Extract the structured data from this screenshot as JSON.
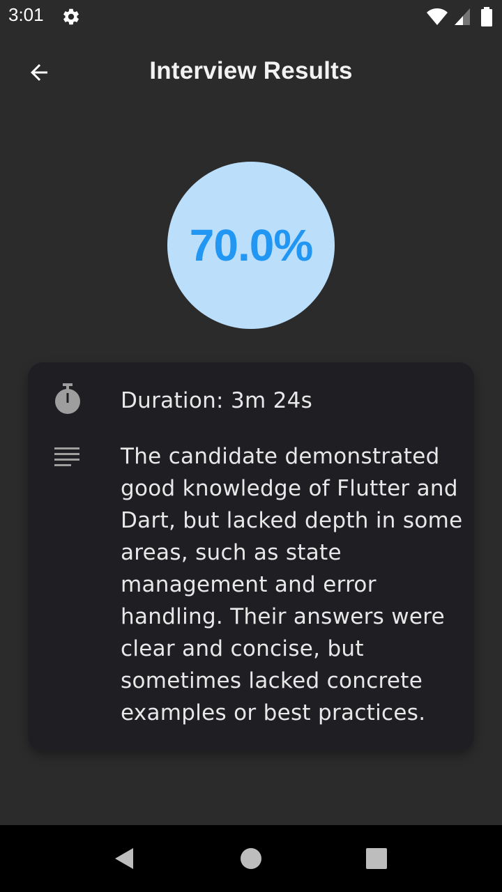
{
  "status_bar": {
    "time": "3:01",
    "icons": [
      "gear-icon",
      "wifi-icon",
      "signal-icon",
      "battery-icon"
    ]
  },
  "app_bar": {
    "title": "Interview Results",
    "back_icon": "arrow-left-icon"
  },
  "score": {
    "label": "70.0%",
    "value": 70.0,
    "circle_color": "#bbdefb",
    "text_color": "#2196f3"
  },
  "details": {
    "duration_icon": "timer-icon",
    "duration": "Duration: 3m 24s",
    "summary_icon": "notes-icon",
    "summary": "The candidate demonstrated good knowledge of Flutter and Dart, but lacked depth in some areas, such as state management and error handling. Their answers were clear and concise, but sometimes lacked concrete examples or best practices."
  },
  "nav_bar": {
    "icons": [
      "back-triangle-icon",
      "home-circle-icon",
      "recents-square-icon"
    ]
  },
  "colors": {
    "background": "#2b2b2b",
    "card": "#1f1e22",
    "nav_bar": "#000000"
  }
}
